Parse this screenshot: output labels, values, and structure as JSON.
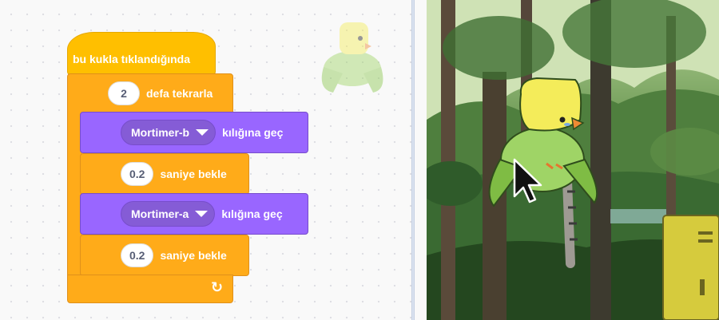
{
  "script": {
    "hat_label": "bu kukla tıklandığında",
    "repeat": {
      "count": "2",
      "label": "defa tekrarla"
    },
    "steps": [
      {
        "costume": "Mortimer-b",
        "label": "kılığına geç"
      },
      {
        "seconds": "0.2",
        "label": "saniye bekle"
      },
      {
        "costume": "Mortimer-a",
        "label": "kılığına geç"
      },
      {
        "seconds": "0.2",
        "label": "saniye bekle"
      }
    ]
  },
  "colors": {
    "events": "#ffbf00",
    "control": "#ffab19",
    "looks": "#9966ff"
  },
  "icons": {
    "repeat_loop": "loop-arrow-icon",
    "cursor": "mouse-pointer-icon"
  }
}
